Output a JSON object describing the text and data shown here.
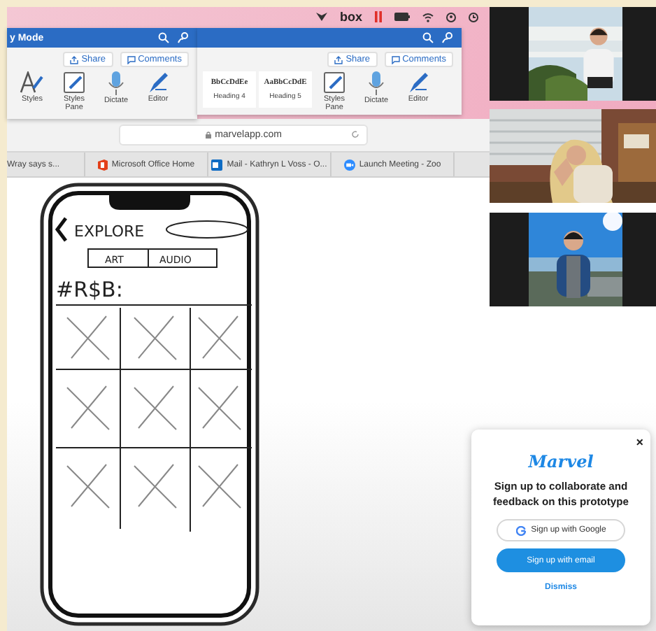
{
  "menu_bar": {
    "logo": "box"
  },
  "word_windows": [
    {
      "title": "y Mode",
      "share": "Share",
      "comments": "Comments",
      "tools": [
        {
          "kind": "styles",
          "label": "Styles"
        },
        {
          "kind": "pane",
          "label": "Styles Pane"
        },
        {
          "kind": "dictate",
          "label": "Dictate"
        },
        {
          "kind": "editor",
          "label": "Editor"
        }
      ]
    },
    {
      "share": "Share",
      "comments": "Comments",
      "tools": [
        {
          "kind": "sample",
          "sample": "BbCcDdEe",
          "label": "Heading 4"
        },
        {
          "kind": "sample",
          "sample": "AaBbCcDdE",
          "label": "Heading 5"
        },
        {
          "kind": "pane",
          "label": "Styles Pane"
        },
        {
          "kind": "dictate",
          "label": "Dictate"
        },
        {
          "kind": "editor",
          "label": "Editor"
        }
      ]
    }
  ],
  "browser": {
    "url": "marvelapp.com",
    "tabs": [
      {
        "kind": "plain",
        "label": "Wray says s..."
      },
      {
        "kind": "office",
        "label": "Microsoft Office Home"
      },
      {
        "kind": "mail",
        "label": "Mail - Kathryn L Voss - O..."
      },
      {
        "kind": "meeting",
        "label": "Launch Meeting - Zoo"
      }
    ]
  },
  "prototype": {
    "title": "EXPLORE",
    "tabs": [
      "ART",
      "AUDIO"
    ],
    "heading": "#R$B:"
  },
  "popup": {
    "logo": "Marvel",
    "message": "Sign up to collaborate and feedback on this prototype",
    "google_button": "Sign up with Google",
    "email_button": "Sign up with email",
    "dismiss": "Dismiss",
    "close": "×"
  }
}
